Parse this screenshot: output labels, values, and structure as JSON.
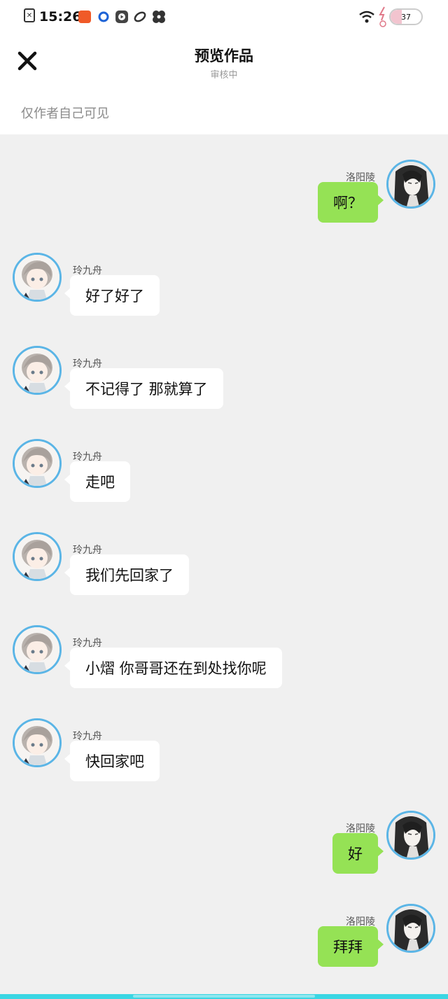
{
  "status_bar": {
    "time": "15:26",
    "battery": 37,
    "icons": [
      "file-x-icon",
      "orange-app-icon",
      "blue-app-icon",
      "play-app-icon",
      "swirl-app-icon",
      "fan-app-icon",
      "wifi-icon",
      "charging-icon",
      "battery-icon"
    ]
  },
  "header": {
    "title": "预览作品",
    "subtitle": "审核中",
    "visibility_note": "仅作者自己可见",
    "close_icon": "close-icon"
  },
  "messages": [
    {
      "side": "right",
      "sender": "洛阳陵",
      "text": "啊？"
    },
    {
      "side": "left",
      "sender": "玲九舟",
      "text": "好了好了"
    },
    {
      "side": "left",
      "sender": "玲九舟",
      "text": "不记得了 那就算了"
    },
    {
      "side": "left",
      "sender": "玲九舟",
      "text": "走吧"
    },
    {
      "side": "left",
      "sender": "玲九舟",
      "text": "我们先回家了"
    },
    {
      "side": "left",
      "sender": "玲九舟",
      "text": "小熠 你哥哥还在到处找你呢"
    },
    {
      "side": "left",
      "sender": "玲九舟",
      "text": "快回家吧"
    },
    {
      "side": "right",
      "sender": "洛阳陵",
      "text": "好"
    },
    {
      "side": "right",
      "sender": "洛阳陵",
      "text": "拜拜"
    }
  ],
  "colors": {
    "avatar_ring": "#5bb5e6",
    "right_bubble": "#95e255",
    "left_bubble": "#ffffff",
    "chat_background": "#f0f0f0",
    "bottom_bar": "#3ad6e3"
  }
}
